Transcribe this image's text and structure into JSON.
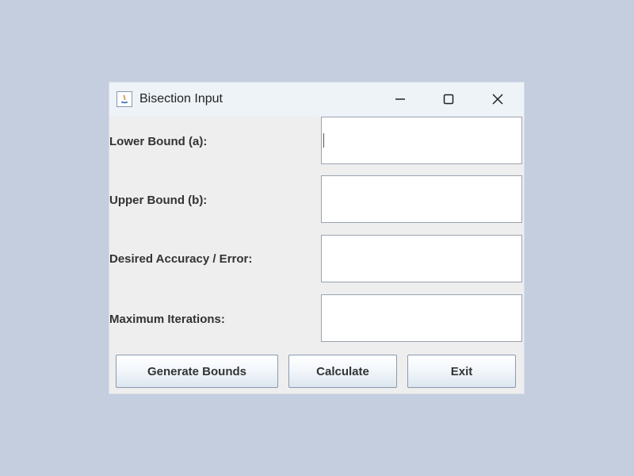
{
  "window": {
    "title": "Bisection Input",
    "icon": "java-app-icon",
    "controls": [
      "minimize-icon",
      "maximize-icon",
      "close-icon"
    ]
  },
  "form": {
    "lower_bound": {
      "label": "Lower Bound (a):",
      "value": ""
    },
    "upper_bound": {
      "label": "Upper Bound (b):",
      "value": ""
    },
    "accuracy": {
      "label": "Desired Accuracy / Error:",
      "value": ""
    },
    "max_iterations": {
      "label": "Maximum Iterations:",
      "value": ""
    }
  },
  "buttons": {
    "generate": "Generate Bounds",
    "calculate": "Calculate",
    "exit": "Exit"
  },
  "colors": {
    "desktop": "#c5cedf",
    "window_bg": "#eeeeee",
    "titlebar_bg": "#eef3f8",
    "field_border": "#9aa3ae"
  }
}
